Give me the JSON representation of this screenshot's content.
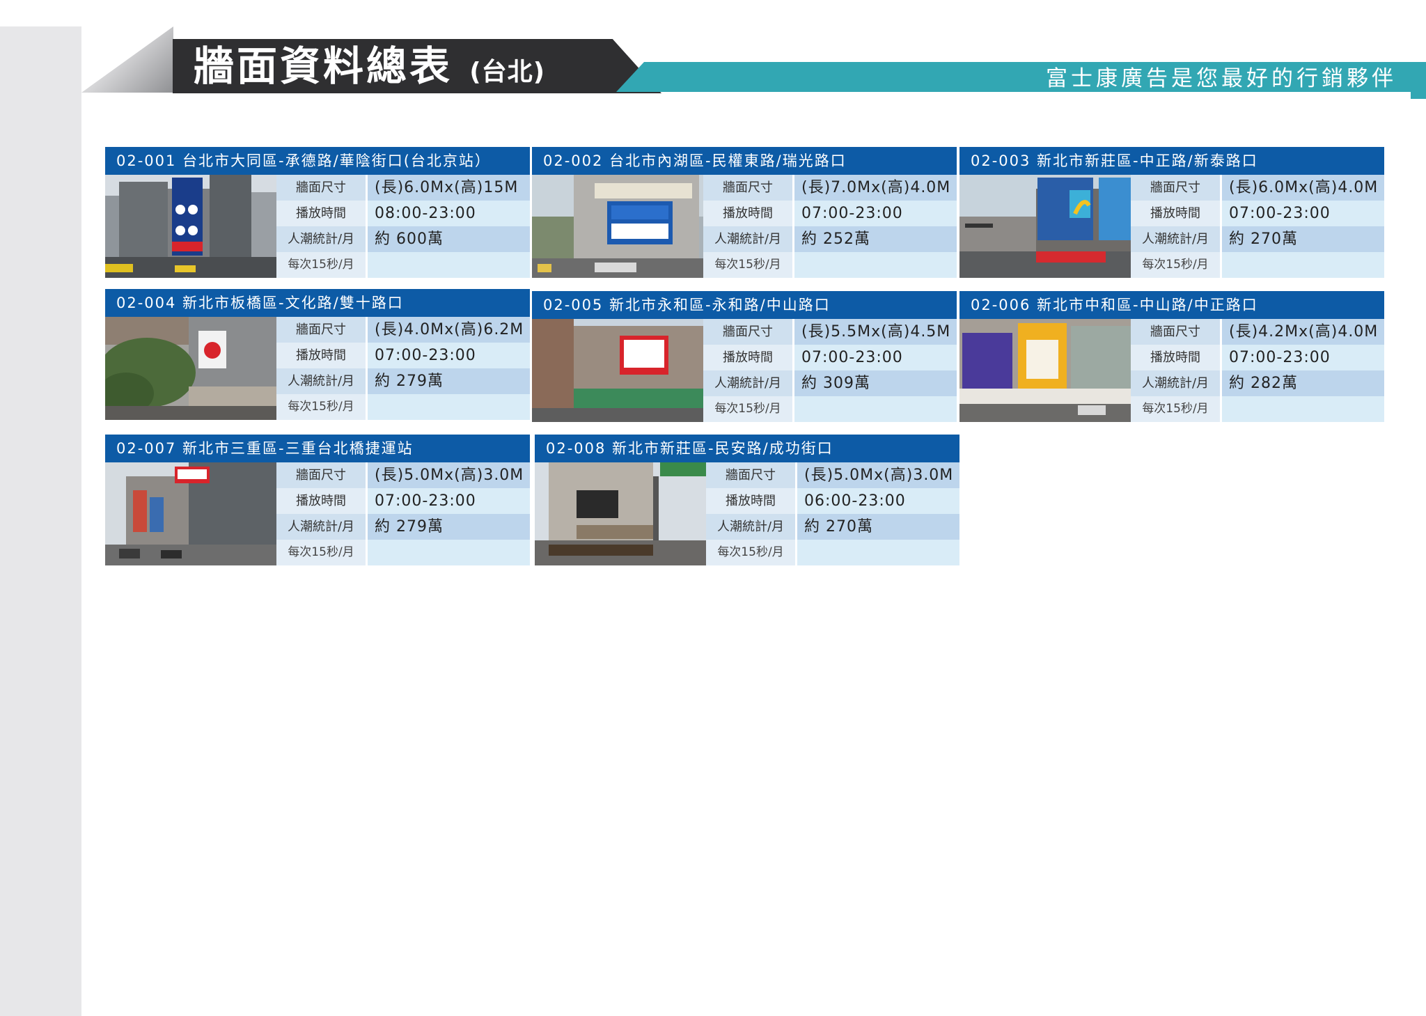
{
  "header": {
    "title": "牆面資料總表",
    "title_sub": "(台北)",
    "slogan": "富士康廣告是您最好的行銷夥伴"
  },
  "labels": {
    "size": "牆面尺寸",
    "hours": "播放時間",
    "traffic": "人潮統計/月",
    "per": "每次15秒/月"
  },
  "cards": [
    {
      "title": "02-001 台北市大同區-承德路/華陰街口(台北京站）",
      "size": "(長)6.0Mx(高)15M",
      "hours": "08:00-23:00",
      "traffic": "約 600萬",
      "per_value": ""
    },
    {
      "title": "02-002 台北市內湖區-民權東路/瑞光路口",
      "size": "(長)7.0Mx(高)4.0M",
      "hours": "07:00-23:00",
      "traffic": "約 252萬",
      "per_value": ""
    },
    {
      "title": "02-003 新北市新莊區-中正路/新泰路口",
      "size": "(長)6.0Mx(高)4.0M",
      "hours": "07:00-23:00",
      "traffic": "約 270萬",
      "per_value": ""
    },
    {
      "title": "02-004 新北市板橋區-文化路/雙十路口",
      "size": "(長)4.0Mx(高)6.2M",
      "hours": "07:00-23:00",
      "traffic": "約 279萬",
      "per_value": ""
    },
    {
      "title": "02-005 新北市永和區-永和路/中山路口",
      "size": "(長)5.5Mx(高)4.5M",
      "hours": "07:00-23:00",
      "traffic": "約 309萬",
      "per_value": ""
    },
    {
      "title": "02-006 新北市中和區-中山路/中正路口",
      "size": "(長)4.2Mx(高)4.0M",
      "hours": "07:00-23:00",
      "traffic": "約 282萬",
      "per_value": ""
    },
    {
      "title": "02-007 新北市三重區-三重台北橋捷運站",
      "size": "(長)5.0Mx(高)3.0M",
      "hours": "07:00-23:00",
      "traffic": "約 279萬",
      "per_value": ""
    },
    {
      "title": "02-008 新北市新莊區-民安路/成功街口",
      "size": "(長)5.0Mx(高)3.0M",
      "hours": "06:00-23:00",
      "traffic": "約 270萬",
      "per_value": ""
    }
  ],
  "colors": {
    "header_dark": "#2f2f31",
    "teal": "#32a7b3",
    "card_head": "#0d5ba6"
  }
}
